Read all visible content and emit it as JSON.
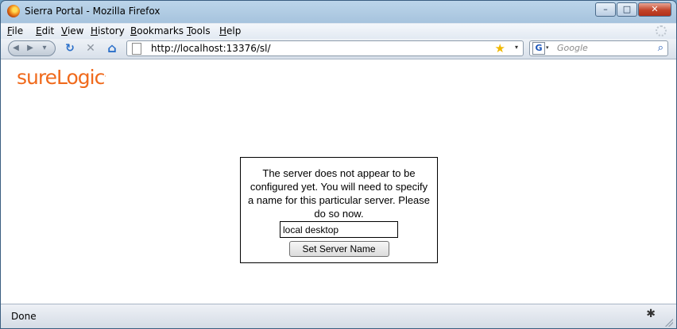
{
  "window": {
    "title": "Sierra Portal - Mozilla Firefox",
    "minimize_glyph": "–",
    "maximize_glyph": "□",
    "close_glyph": "✕"
  },
  "menubar": {
    "items": [
      "File",
      "Edit",
      "View",
      "History",
      "Bookmarks",
      "Tools",
      "Help"
    ]
  },
  "navbar": {
    "back_glyph": "◀",
    "forward_glyph": "▶",
    "dropdown_glyph": "▾",
    "reload_glyph": "↻",
    "stop_glyph": "✕",
    "home_glyph": "⌂",
    "url": "http://localhost:13376/sl/",
    "bookmark_star_glyph": "★",
    "search_engine_glyph": "G",
    "search_placeholder": "Google",
    "search_glyph": "⌕"
  },
  "page": {
    "logo_text": "sureLogic",
    "logo_mark": ".",
    "logo_color": "#f06a1c",
    "message": "The server does not appear to be configured yet. You will need to specify a name for this particular server. Please do so now.",
    "server_name_value": "local desktop",
    "submit_label": "Set Server Name"
  },
  "statusbar": {
    "text": "Done",
    "bug_glyph": "✱"
  }
}
